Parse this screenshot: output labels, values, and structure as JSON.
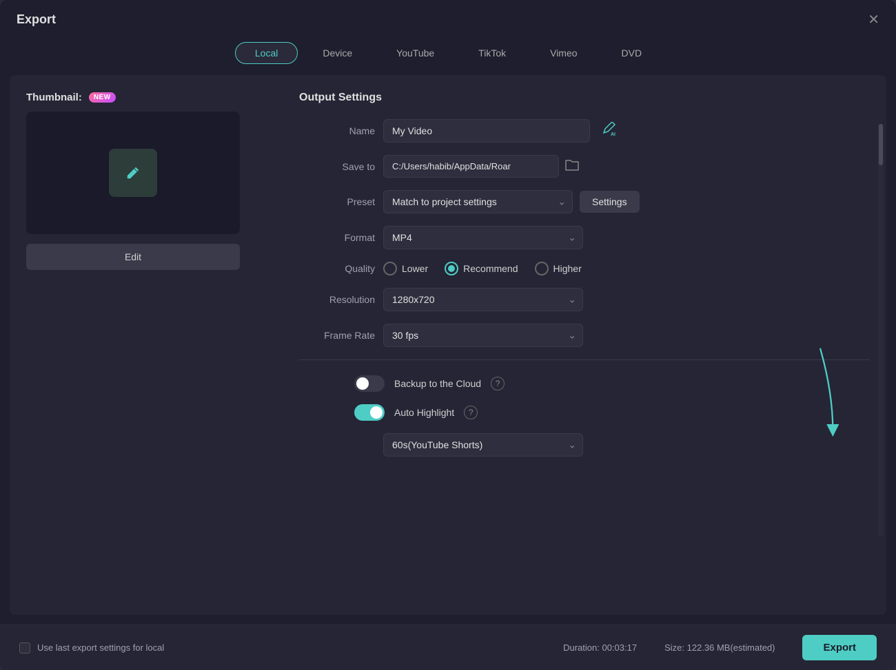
{
  "window": {
    "title": "Export",
    "close_label": "✕"
  },
  "tabs": [
    {
      "id": "local",
      "label": "Local",
      "active": true
    },
    {
      "id": "device",
      "label": "Device",
      "active": false
    },
    {
      "id": "youtube",
      "label": "YouTube",
      "active": false
    },
    {
      "id": "tiktok",
      "label": "TikTok",
      "active": false
    },
    {
      "id": "vimeo",
      "label": "Vimeo",
      "active": false
    },
    {
      "id": "dvd",
      "label": "DVD",
      "active": false
    }
  ],
  "thumbnail": {
    "label": "Thumbnail:",
    "badge": "NEW",
    "edit_btn": "Edit"
  },
  "output_settings": {
    "title": "Output Settings",
    "name_label": "Name",
    "name_value": "My Video",
    "save_to_label": "Save to",
    "save_to_value": "C:/Users/habib/AppData/Roar",
    "preset_label": "Preset",
    "preset_value": "Match to project settings",
    "settings_btn": "Settings",
    "format_label": "Format",
    "format_value": "MP4",
    "quality_label": "Quality",
    "quality_options": [
      {
        "id": "lower",
        "label": "Lower",
        "checked": false
      },
      {
        "id": "recommend",
        "label": "Recommend",
        "checked": true
      },
      {
        "id": "higher",
        "label": "Higher",
        "checked": false
      }
    ],
    "resolution_label": "Resolution",
    "resolution_value": "1280x720",
    "frame_rate_label": "Frame Rate",
    "frame_rate_value": "30 fps",
    "backup_label": "Backup to the Cloud",
    "backup_enabled": false,
    "auto_highlight_label": "Auto Highlight",
    "auto_highlight_enabled": true,
    "shorts_value": "60s(YouTube Shorts)"
  },
  "bottom": {
    "checkbox_label": "Use last export settings for local",
    "duration_label": "Duration: 00:03:17",
    "size_label": "Size: 122.36 MB(estimated)",
    "export_btn": "Export"
  },
  "icons": {
    "pencil": "✏",
    "folder": "📁",
    "ai_suffix": "AI",
    "help": "?"
  }
}
